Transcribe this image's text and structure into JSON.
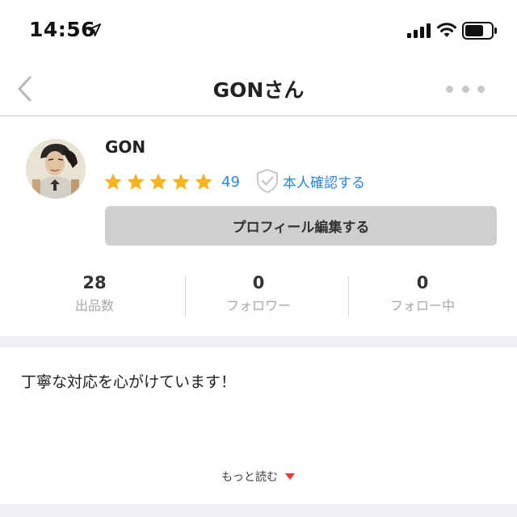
{
  "status_bar": {
    "time": "14:56",
    "icons": [
      "location-arrow-icon",
      "cellular-signal-icon",
      "wifi-icon",
      "battery-icon"
    ]
  },
  "nav": {
    "title": "GONさん",
    "back_icon": "chevron-left-icon",
    "more_icon": "more-dots-icon"
  },
  "profile": {
    "username": "GON",
    "rating_stars": 5,
    "rating_count": "49",
    "verified_label": "本人確認する",
    "edit_button_label": "プロフィール編集する"
  },
  "stats": [
    {
      "value": "28",
      "label": "出品数"
    },
    {
      "value": "0",
      "label": "フォロワー"
    },
    {
      "value": "0",
      "label": "フォロー中"
    }
  ],
  "bio": {
    "text": "丁寧な対応を心がけています！",
    "read_more_label": "もっと読む"
  },
  "colors": {
    "accent_blue": "#2a86d4",
    "star_yellow": "#f5b323",
    "read_more_red": "#e53935",
    "band_gray": "#efeff4",
    "button_gray": "#cfcfcf"
  }
}
